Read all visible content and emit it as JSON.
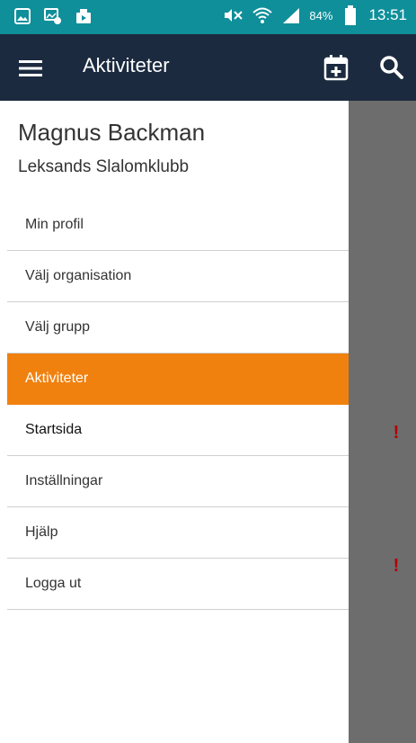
{
  "status_bar": {
    "battery": "84%",
    "time": "13:51",
    "icons_left": [
      "gallery-icon",
      "screenshot-icon",
      "video-icon"
    ],
    "icons_right": [
      "mute-icon",
      "wifi-icon",
      "signal-icon",
      "battery-icon"
    ]
  },
  "app_bar": {
    "title": "Aktiviteter",
    "icons": [
      "hamburger-menu-icon",
      "calendar-add-icon",
      "search-icon"
    ]
  },
  "drawer": {
    "user_name": "Magnus Backman",
    "club_name": "Leksands Slalomklubb",
    "items": [
      {
        "label": "Min profil"
      },
      {
        "label": "Välj organisation"
      },
      {
        "label": "Välj grupp"
      },
      {
        "label": "Aktiviteter",
        "active": true
      },
      {
        "label": "Startsida"
      },
      {
        "label": "Inställningar"
      },
      {
        "label": "Hjälp"
      },
      {
        "label": "Logga ut"
      }
    ]
  },
  "background": {
    "alert_mark": "!"
  },
  "colors": {
    "status_bar": "#0f8f9a",
    "app_bar": "#1b2a3f",
    "active_item": "#f0810f",
    "scrim": "#6d6d6d",
    "alert": "#b00000"
  }
}
